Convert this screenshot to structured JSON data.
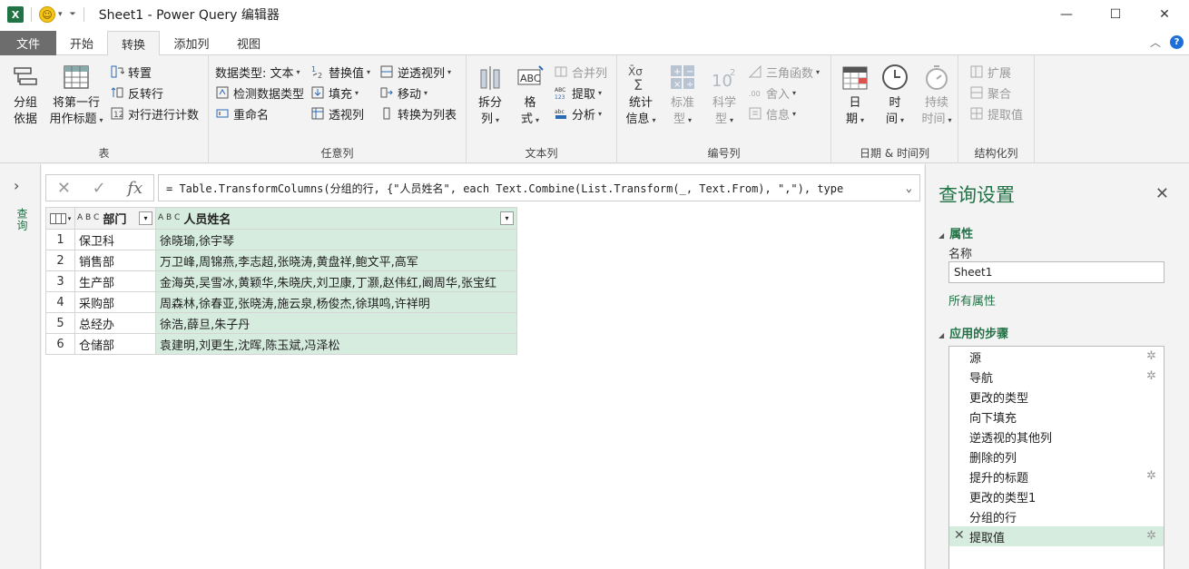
{
  "window": {
    "title": "Sheet1 - Power Query 编辑器",
    "app_icon": "X",
    "controls": {
      "minimize": "—",
      "maximize": "☐",
      "close": "✕"
    }
  },
  "tabs": [
    {
      "label": "文件"
    },
    {
      "label": "开始"
    },
    {
      "label": "转换"
    },
    {
      "label": "添加列"
    },
    {
      "label": "视图"
    }
  ],
  "ribbon": {
    "table": {
      "label": "表",
      "group_by_1": "分组",
      "group_by_2": "依据",
      "first_row_1": "将第一行",
      "first_row_2": "用作标题",
      "transpose": "转置",
      "reverse_rows": "反转行",
      "count_rows": "对行进行计数"
    },
    "any_column": {
      "label": "任意列",
      "data_type": "数据类型: 文本",
      "detect_type": "检测数据类型",
      "rename": "重命名",
      "replace_values": "替换值",
      "fill": "填充",
      "pivot": "透视列",
      "unpivot": "逆透视列",
      "move": "移动",
      "to_list": "转换为列表"
    },
    "text_column": {
      "label": "文本列",
      "split_1": "拆分",
      "split_2": "列",
      "format_1": "格",
      "format_2": "式",
      "merge": "合并列",
      "extract": "提取",
      "parse": "分析"
    },
    "number_column": {
      "label": "编号列",
      "stats_1": "统计",
      "stats_2": "信息",
      "standard_1": "标准",
      "standard_2": "型",
      "scientific_1": "科学",
      "scientific_2": "型",
      "trig": "三角函数",
      "rounding": "舍入",
      "info": "信息"
    },
    "datetime": {
      "label": "日期 & 时间列",
      "date_1": "日",
      "date_2": "期",
      "time_1": "时",
      "time_2": "间",
      "duration_1": "持续",
      "duration_2": "时间"
    },
    "structured": {
      "label": "结构化列",
      "expand": "扩展",
      "aggregate": "聚合",
      "extract_values": "提取值"
    }
  },
  "formula": {
    "cancel": "✕",
    "confirm": "✓",
    "fx": "fx",
    "text": "= Table.TransformColumns(分组的行, {\"人员姓名\", each Text.Combine(List.Transform(_, Text.From), \",\"), type"
  },
  "left_pane": {
    "label": "查询"
  },
  "grid": {
    "type_label": "A B C",
    "columns": [
      "部门",
      "人员姓名"
    ],
    "rows": [
      {
        "n": "1",
        "dept": "保卫科",
        "names": "徐晓瑜,徐宇琴"
      },
      {
        "n": "2",
        "dept": "销售部",
        "names": "万卫峰,周锦燕,李志超,张晓涛,黄盘祥,鲍文平,高军"
      },
      {
        "n": "3",
        "dept": "生产部",
        "names": "金海英,吴雪冰,黄颖华,朱晓庆,刘卫康,丁灏,赵伟红,阚周华,张宝红"
      },
      {
        "n": "4",
        "dept": "采购部",
        "names": "周森林,徐春亚,张晓涛,施云泉,杨俊杰,徐琪鸣,许祥明"
      },
      {
        "n": "5",
        "dept": "总经办",
        "names": "徐浩,薛旦,朱子丹"
      },
      {
        "n": "6",
        "dept": "仓储部",
        "names": "袁建明,刘更生,沈晖,陈玉斌,冯泽松"
      }
    ]
  },
  "settings": {
    "title": "查询设置",
    "properties": "属性",
    "name_label": "名称",
    "name_value": "Sheet1",
    "all_properties": "所有属性",
    "applied_steps": "应用的步骤",
    "steps": [
      {
        "label": "源",
        "gear": true
      },
      {
        "label": "导航",
        "gear": true
      },
      {
        "label": "更改的类型",
        "gear": false
      },
      {
        "label": "向下填充",
        "gear": false
      },
      {
        "label": "逆透视的其他列",
        "gear": false
      },
      {
        "label": "删除的列",
        "gear": false
      },
      {
        "label": "提升的标题",
        "gear": true
      },
      {
        "label": "更改的类型1",
        "gear": false
      },
      {
        "label": "分组的行",
        "gear": false
      },
      {
        "label": "提取值",
        "gear": true,
        "active": true
      }
    ]
  },
  "colors": {
    "accent": "#217346",
    "selection": "#d6ecdf",
    "file_tab": "#6d6d6d"
  }
}
